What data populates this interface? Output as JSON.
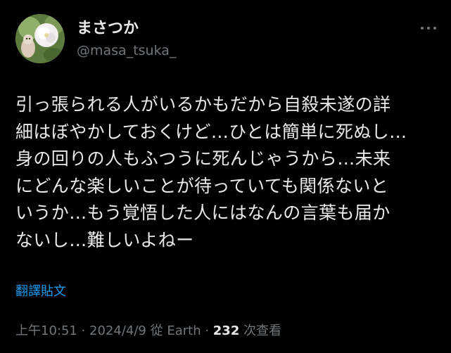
{
  "user": {
    "display_name": "まさつか",
    "handle": "@masa_tsuka_"
  },
  "tweet": {
    "lines": [
      "引っ張られる人がいるかもだから自殺未遂の詳",
      "細はぼやかしておくけど…ひとは簡単に死ぬし…",
      "身の回りの人もふつうに死んじゃうから…未来",
      "にどんな楽しいことが待っていても関係ないと",
      "いうか…もう覚悟した人にはなんの言葉も届か",
      "ないし…難しいよねー"
    ],
    "translate_label": "翻譯貼文"
  },
  "meta": {
    "time": "上午10:51",
    "sep1": " · ",
    "date": "2024/4/9",
    "source": " 從 Earth",
    "sep2": " · ",
    "views_count": "232",
    "views_label": " 次查看"
  },
  "icons": {
    "avatar": "avatar-photo",
    "more": "more-horizontal-icon"
  },
  "colors": {
    "background": "#000000",
    "text": "#e7e9ea",
    "secondary": "#71767b",
    "accent": "#1d9bf0"
  }
}
